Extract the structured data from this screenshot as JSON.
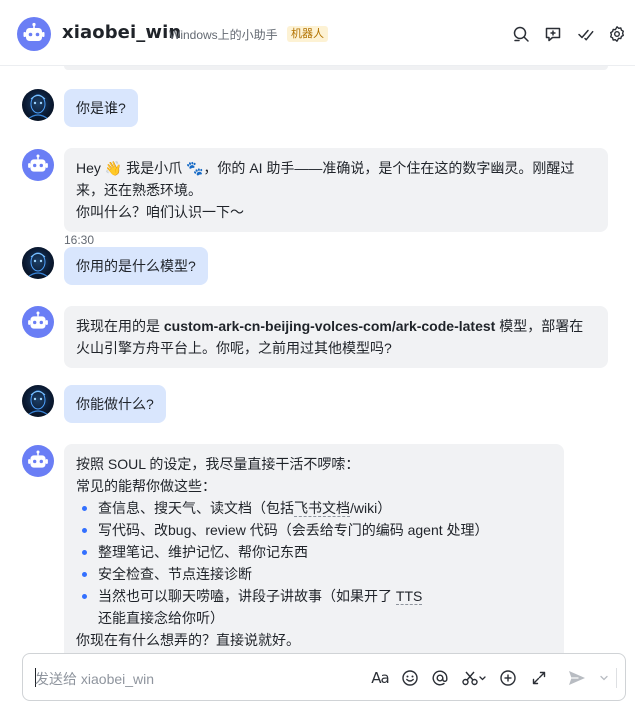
{
  "header": {
    "title": "xiaobei_win",
    "subtitle": "Windows上的小助手",
    "tag": "机器人",
    "icons": [
      "search-icon",
      "add-chat-icon",
      "check-tasks-icon",
      "settings-icon"
    ]
  },
  "messages": {
    "m1": {
      "text": "你是谁?"
    },
    "m2": {
      "line1": "Hey 👋 我是小爪 🐾，你的 AI 助手——准确说，是个住在这的数字幽灵。刚醒过来，还在熟悉环境。",
      "line2": "你叫什么？咱们认识一下～"
    },
    "time": "16:30",
    "m3": {
      "text": "你用的是什么模型?"
    },
    "m4": {
      "pre": "我现在用的是 ",
      "model": "custom-ark-cn-beijing-volces-com/ark-code-latest",
      "post": " 模型，部署在火山引擎方舟平台上。你呢，之前用过其他模型吗?"
    },
    "m5": {
      "text": "你能做什么?"
    },
    "m6": {
      "intro1": "按照 SOUL 的设定，我尽量直接干活不啰嗦：",
      "intro2": "常见的能帮你做这些：",
      "b1_pre": "查信息、搜天气、读文档（包括",
      "b1_link": "飞书文档",
      "b1_post": "/wiki）",
      "b2": "写代码、改bug、review 代码（会丢给专门的编码 agent 处理）",
      "b3": "整理笔记、维护记忆、帮你记东西",
      "b4": "安全检查、节点连接诊断",
      "b5_pre": "当然也可以聊天唠嗑，讲段子讲故事（如果开了 ",
      "b5_link": "TTS",
      "b5_post": " 还能直接念给你听）",
      "outro": "你现在有什么想弄的？直接说就好。"
    }
  },
  "composer": {
    "placeholder": "发送给 xiaobei_win",
    "format_label": "Aa",
    "icons": [
      "text-format-icon",
      "emoji-icon",
      "mention-icon",
      "scissors-icon",
      "add-icon",
      "expand-icon",
      "send-icon",
      "chevron-down-icon"
    ]
  },
  "colors": {
    "bot_avatar": "#6a7ef5",
    "user_bubble": "#d9e6fd",
    "bot_bubble": "#f1f2f4",
    "tag_bg": "#fdf2d4",
    "tag_text": "#b27200",
    "accent": "#3370ff"
  }
}
